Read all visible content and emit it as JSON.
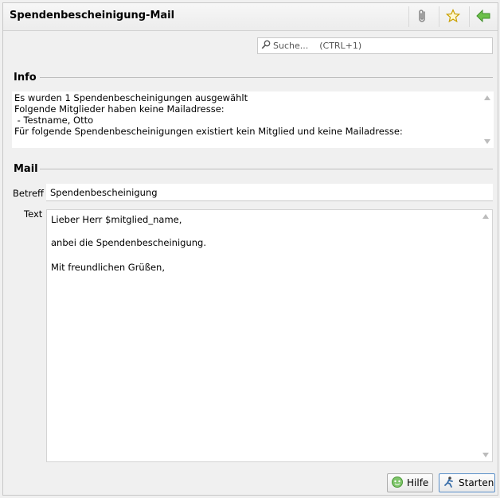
{
  "window": {
    "title": "Spendenbescheinigung-Mail"
  },
  "toolbar": {
    "attach_icon": "paperclip-icon",
    "bookmark_icon": "star-icon",
    "back_icon": "green-arrow-left-icon"
  },
  "search": {
    "placeholder": "Suche...    (CTRL+1)"
  },
  "info": {
    "group_title": "Info",
    "lines": [
      "Es wurden 1 Spendenbescheinigungen ausgewählt",
      "Folgende Mitglieder haben keine Mailadresse:",
      " - Testname, Otto",
      "Für folgende Spendenbescheinigungen existiert kein Mitglied und keine Mailadresse:"
    ]
  },
  "mail": {
    "group_title": "Mail",
    "betreff_label": "Betreff",
    "betreff_value": "Spendenbescheinigung",
    "text_label": "Text",
    "text_lines": [
      "Lieber Herr $mitglied_name,",
      "anbei die Spendenbescheinigung.",
      "Mit freundlichen Grüßen,"
    ]
  },
  "buttons": {
    "help_label": "Hilfe",
    "start_label": "Starten"
  }
}
